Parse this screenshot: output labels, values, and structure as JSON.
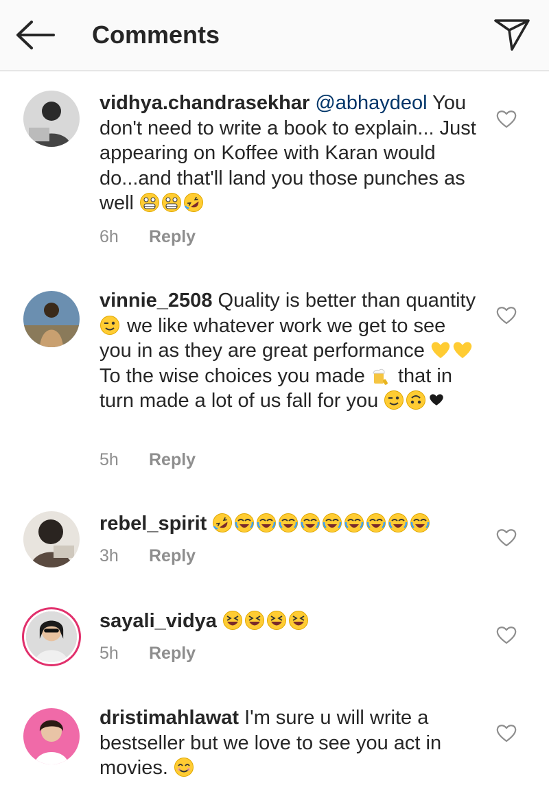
{
  "header": {
    "title": "Comments"
  },
  "comments": [
    {
      "username": "vidhya.chandrasekhar",
      "mention": "@abhaydeol",
      "text_a": " You don't need to write a book to explain... Just appearing on Koffee with Karan would do...and that'll land you those punches as well ",
      "time": "6h",
      "reply_label": "Reply"
    },
    {
      "username": "vinnie_2508",
      "text_a": " Quality is better than quantity ",
      "text_b": " we like whatever work we get to see you in as they are great performance ",
      "text_c": " To the wise choices you made ",
      "text_d": " that in turn made a lot of us fall for you ",
      "time": "5h",
      "reply_label": "Reply"
    },
    {
      "username": "rebel_spirit",
      "text_a": " ",
      "time": "3h",
      "reply_label": "Reply"
    },
    {
      "username": "sayali_vidya",
      "text_a": " ",
      "time": "5h",
      "reply_label": "Reply"
    },
    {
      "username": "dristimahlawat",
      "text_a": " I'm sure u will write a bestseller but we love to see you act in movies. "
    }
  ],
  "colors": {
    "accent_link": "#003569",
    "muted": "#8e8e8e",
    "story_ring": "#e1306c",
    "emoji_yellow": "#ffcc33"
  },
  "icons": [
    "back-arrow-icon",
    "send-icon",
    "heart-icon",
    "grimacing-emoji",
    "rofl-emoji",
    "wink-emoji",
    "yellow-heart-emoji",
    "beer-mug-emoji",
    "upside-down-emoji",
    "black-heart-emoji",
    "joy-emoji",
    "laughing-emoji",
    "smile-emoji"
  ]
}
